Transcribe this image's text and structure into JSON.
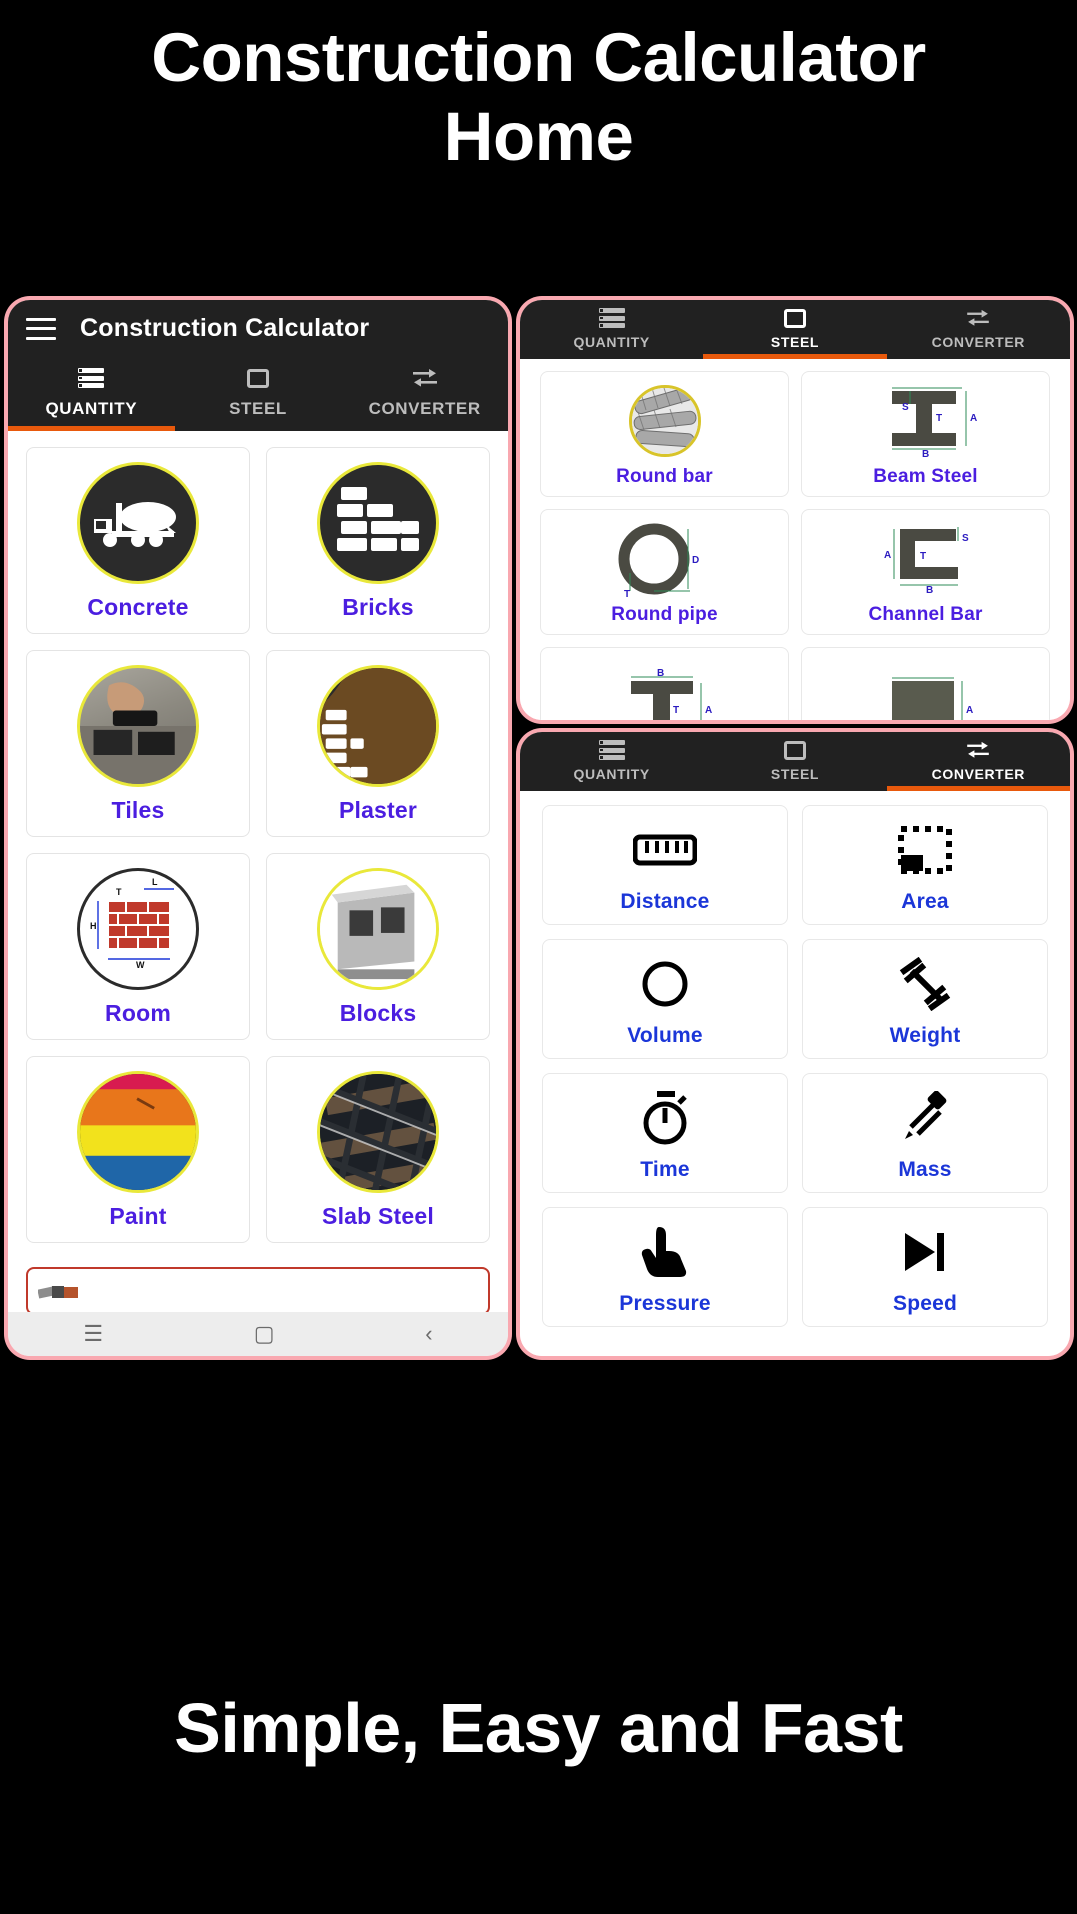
{
  "promo": {
    "headline_line1": "Construction Calculator",
    "headline_line2": "Home",
    "footer": "Simple, Easy and Fast",
    "bg_color": "#000000",
    "text_color": "#ffffff",
    "phone_frame_color": "#F9A8B0"
  },
  "theme": {
    "appbar_bg": "#212121",
    "tab_active_indicator": "#E8590C",
    "quantity_label_color": "#4B1EE0",
    "converter_label_color": "#1B36D8",
    "icon_ring_color": "#E9E83A"
  },
  "app": {
    "title": "Construction Calculator",
    "menu_icon": "hamburger-menu-icon",
    "tabs": [
      {
        "label": "QUANTITY",
        "icon": "list-icon"
      },
      {
        "label": "STEEL",
        "icon": "square-icon"
      },
      {
        "label": "CONVERTER",
        "icon": "swap-arrows-icon"
      }
    ]
  },
  "quantity_screen": {
    "active_tab": "QUANTITY",
    "items": [
      {
        "label": "Concrete",
        "icon": "concrete-mixer-truck-icon"
      },
      {
        "label": "Bricks",
        "icon": "brick-wall-icon"
      },
      {
        "label": "Tiles",
        "icon": "tile-laying-photo-icon"
      },
      {
        "label": "Plaster",
        "icon": "plaster-wall-icon"
      },
      {
        "label": "Room",
        "icon": "room-dimensions-icon"
      },
      {
        "label": "Blocks",
        "icon": "hollow-block-icon"
      },
      {
        "label": "Paint",
        "icon": "paint-stripes-icon"
      },
      {
        "label": "Slab Steel",
        "icon": "rebar-mesh-photo-icon"
      }
    ],
    "ad_banner": "ad-banner-placeholder",
    "nav_buttons": [
      "recents-button",
      "home-button",
      "back-button"
    ]
  },
  "steel_screen": {
    "active_tab": "STEEL",
    "items": [
      {
        "label": "Round bar",
        "icon": "rebar-bundle-photo-icon",
        "dims": []
      },
      {
        "label": "Beam Steel",
        "icon": "i-beam-diagram-icon",
        "dims": [
          "S",
          "T",
          "A",
          "B"
        ]
      },
      {
        "label": "Round pipe",
        "icon": "pipe-ring-diagram-icon",
        "dims": [
          "D",
          "T"
        ]
      },
      {
        "label": "Channel Bar",
        "icon": "channel-bar-diagram-icon",
        "dims": [
          "S",
          "A",
          "T",
          "B"
        ]
      },
      {
        "label": "",
        "icon": "t-bar-diagram-icon",
        "dims": [
          "B",
          "T",
          "A"
        ]
      },
      {
        "label": "",
        "icon": "plate-diagram-icon",
        "dims": [
          "A"
        ]
      }
    ]
  },
  "converter_screen": {
    "active_tab": "CONVERTER",
    "items": [
      {
        "label": "Distance",
        "icon": "ruler-icon"
      },
      {
        "label": "Area",
        "icon": "dashed-area-icon"
      },
      {
        "label": "Volume",
        "icon": "circle-outline-icon"
      },
      {
        "label": "Weight",
        "icon": "dumbbell-icon"
      },
      {
        "label": "Time",
        "icon": "stopwatch-icon"
      },
      {
        "label": "Mass",
        "icon": "pipette-icon"
      },
      {
        "label": "Pressure",
        "icon": "pressing-hand-icon"
      },
      {
        "label": "Speed",
        "icon": "skip-forward-icon"
      }
    ]
  }
}
